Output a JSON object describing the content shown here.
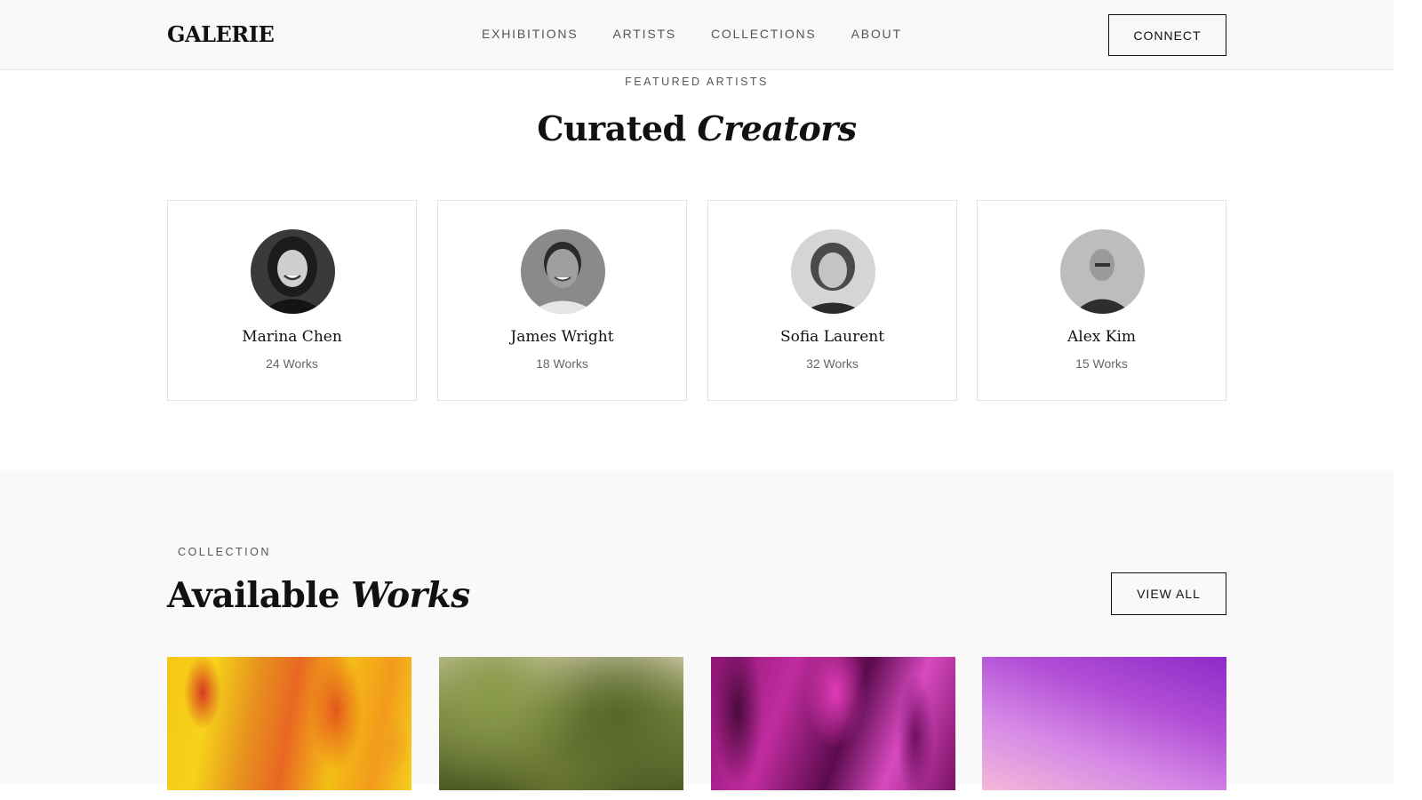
{
  "header": {
    "logo": "GALERIE",
    "nav": [
      "EXHIBITIONS",
      "ARTISTS",
      "COLLECTIONS",
      "ABOUT"
    ],
    "connect_label": "CONNECT"
  },
  "artists_section": {
    "eyebrow": "FEATURED ARTISTS",
    "title_plain": "Curated",
    "title_italic": "Creators",
    "artists": [
      {
        "name": "Marina Chen",
        "works": "24 Works"
      },
      {
        "name": "James Wright",
        "works": "18 Works"
      },
      {
        "name": "Sofia Laurent",
        "works": "32 Works"
      },
      {
        "name": "Alex Kim",
        "works": "15 Works"
      }
    ]
  },
  "collection_section": {
    "eyebrow": "COLLECTION",
    "title_plain": "Available",
    "title_italic": "Works",
    "view_all_label": "VIEW ALL"
  },
  "colors": {
    "background": "#ffffff",
    "header_bg": "#f8f8f8",
    "section_bg": "#f9f9f9",
    "text": "#111111",
    "muted": "#666666",
    "border": "#e3e3e3"
  }
}
